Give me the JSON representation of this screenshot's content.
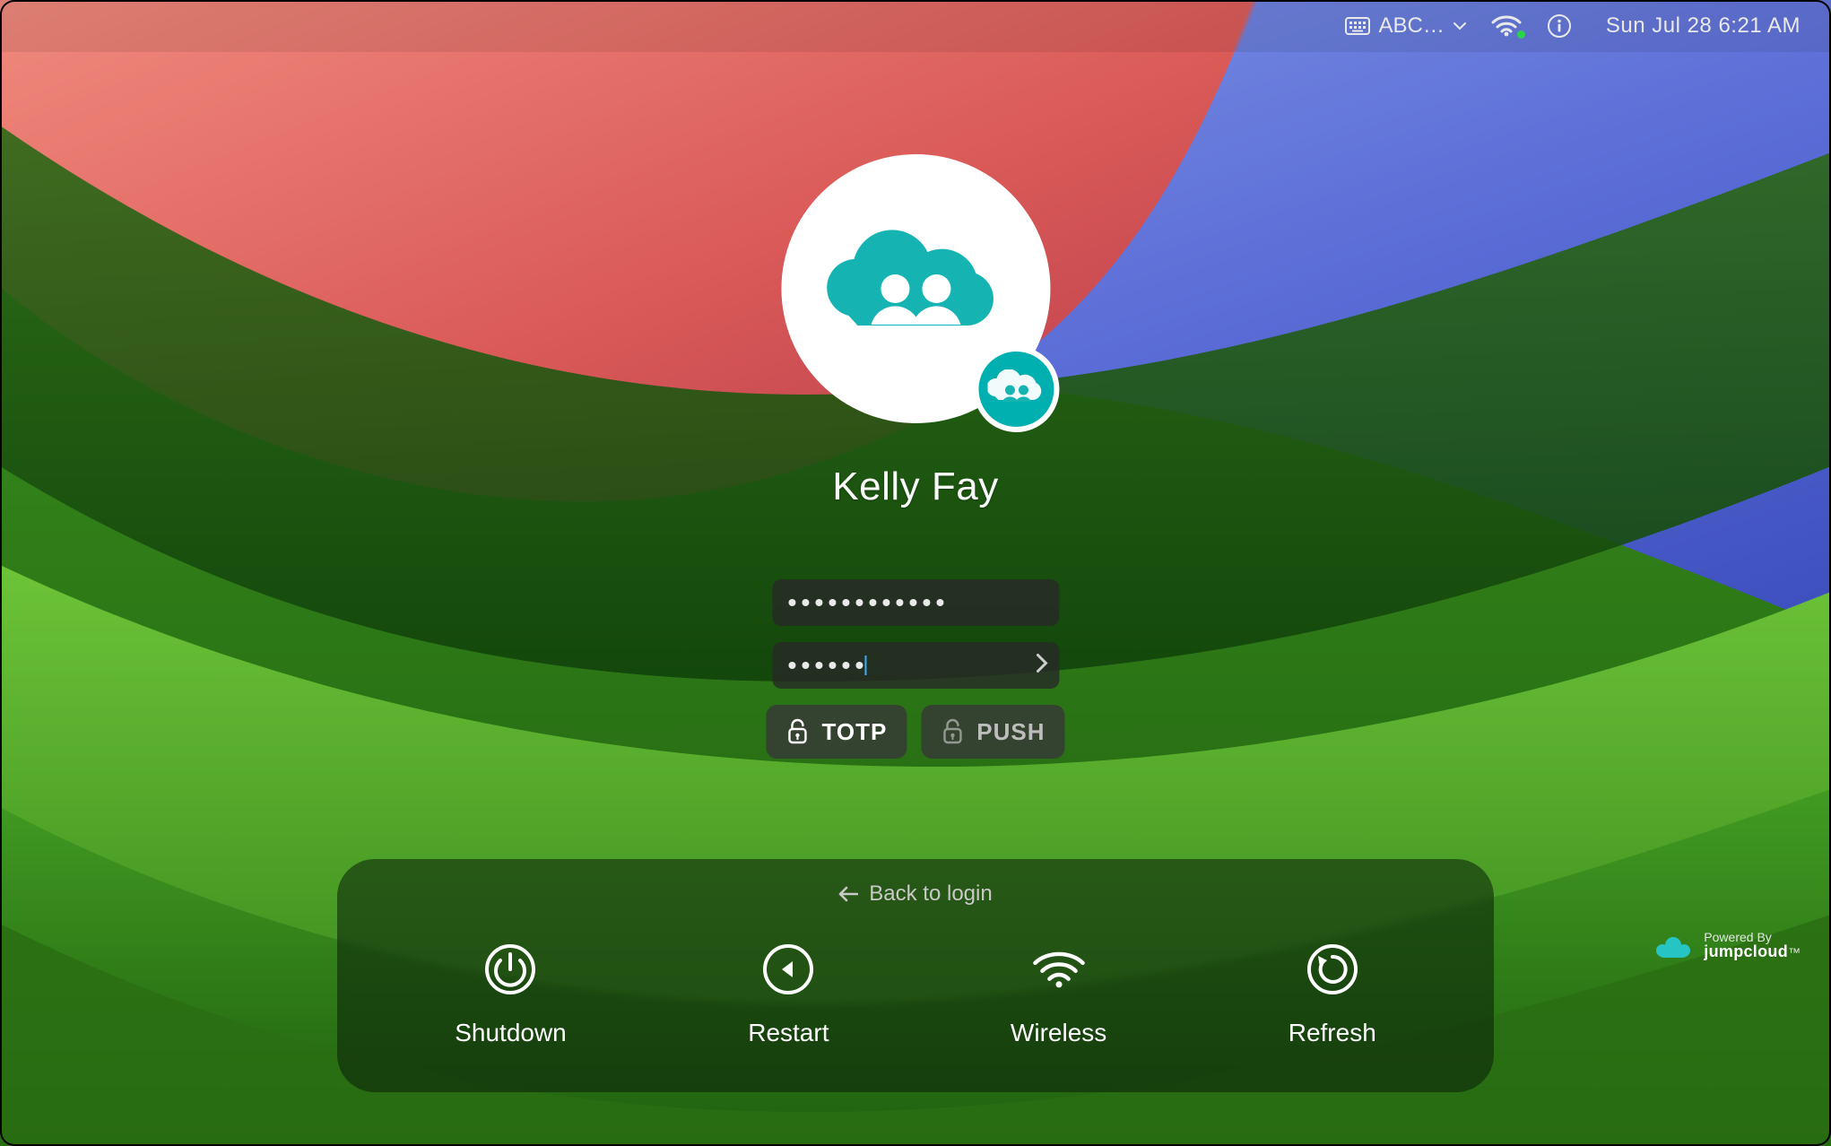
{
  "menubar": {
    "input_source_label": "ABC…",
    "datetime": "Sun Jul 28  6:21 AM"
  },
  "user": {
    "display_name": "Kelly Fay"
  },
  "fields": {
    "password_dots": 12,
    "code_dots": 6
  },
  "mfa": {
    "totp_label": "TOTP",
    "push_label": "PUSH"
  },
  "panel": {
    "back_label": "Back to login",
    "shutdown": "Shutdown",
    "restart": "Restart",
    "wireless": "Wireless",
    "refresh": "Refresh"
  },
  "branding": {
    "powered_by": "Powered By",
    "brand": "jumpcloud",
    "suffix": "™"
  }
}
